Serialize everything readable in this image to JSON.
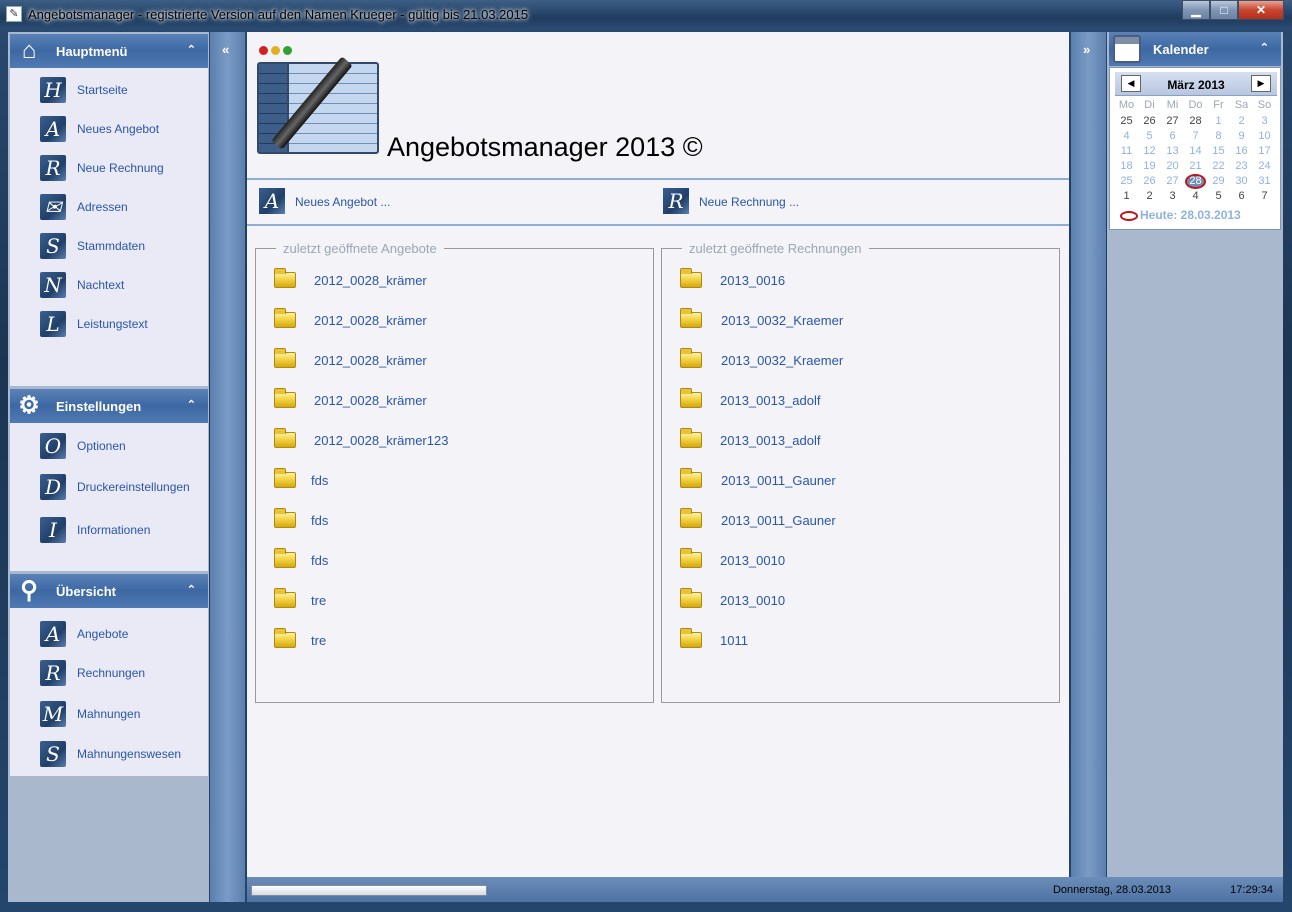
{
  "window": {
    "title": "Angebotsmanager - registrierte Version auf den Namen Krueger - gültig bis 21.03.2015",
    "minimize": "▁",
    "maximize": "□",
    "close": "✕"
  },
  "sidebar": {
    "hauptmenu": {
      "title": "Hauptmenü",
      "icon": "house-icon",
      "items": [
        {
          "letter": "H",
          "label": "Startseite"
        },
        {
          "letter": "A",
          "label": "Neues Angebot"
        },
        {
          "letter": "R",
          "label": "Neue Rechnung"
        },
        {
          "letter": "✉",
          "label": "Adressen"
        },
        {
          "letter": "S",
          "label": "Stammdaten"
        },
        {
          "letter": "N",
          "label": "Nachtext"
        },
        {
          "letter": "L",
          "label": "Leistungstext"
        }
      ]
    },
    "einstellungen": {
      "title": "Einstellungen",
      "icon": "gear-icon",
      "items": [
        {
          "letter": "O",
          "label": "Optionen"
        },
        {
          "letter": "D",
          "label": "Druckereinstellungen"
        },
        {
          "letter": "I",
          "label": "Informationen"
        }
      ]
    },
    "uebersicht": {
      "title": "Übersicht",
      "icon": "magnifier-icon",
      "items": [
        {
          "letter": "A",
          "label": "Angebote"
        },
        {
          "letter": "R",
          "label": "Rechnungen"
        },
        {
          "letter": "M",
          "label": "Mahnungen"
        },
        {
          "letter": "S",
          "label": "Mahnungenswesen"
        }
      ]
    },
    "collapse_chevron": "⌃"
  },
  "strips": {
    "left_chevron": "«",
    "right_chevron": "»"
  },
  "main": {
    "app_title": "Angebotsmanager 2013 ©",
    "quick_links": [
      {
        "letter": "A",
        "label": "Neues Angebot ..."
      },
      {
        "letter": "R",
        "label": "Neue Rechnung ..."
      }
    ],
    "recent_offers": {
      "title": "zuletzt geöffnete Angebote",
      "items": [
        "2012_0028_krämer",
        "2012_0028_krämer",
        "2012_0028_krämer",
        "2012_0028_krämer",
        "2012_0028_krämer123",
        "fds",
        "fds",
        "fds",
        "tre",
        "tre"
      ]
    },
    "recent_invoices": {
      "title": "zuletzt geöffnete Rechnungen",
      "items": [
        "2013_0016",
        "2013_0032_Kraemer",
        "2013_0032_Kraemer",
        "2013_0013_adolf",
        "2013_0013_adolf",
        "2013_0011_Gauner",
        "2013_0011_Gauner",
        "2013_0010",
        "2013_0010",
        "1011"
      ]
    }
  },
  "calendar": {
    "title": "Kalender",
    "month": "März 2013",
    "prev": "◀",
    "next": "▶",
    "weekdays": [
      "Mo",
      "Di",
      "Mi",
      "Do",
      "Fr",
      "Sa",
      "So"
    ],
    "weeks": [
      [
        "25",
        "26",
        "27",
        "28",
        "1",
        "2",
        "3"
      ],
      [
        "4",
        "5",
        "6",
        "7",
        "8",
        "9",
        "10"
      ],
      [
        "11",
        "12",
        "13",
        "14",
        "15",
        "16",
        "17"
      ],
      [
        "18",
        "19",
        "20",
        "21",
        "22",
        "23",
        "24"
      ],
      [
        "25",
        "26",
        "27",
        "28",
        "29",
        "30",
        "31"
      ],
      [
        "1",
        "2",
        "3",
        "4",
        "5",
        "6",
        "7"
      ]
    ],
    "today_label": "Heute: 28.03.2013"
  },
  "statusbar": {
    "progress": 0,
    "date": "Donnerstag, 28.03.2013",
    "time": "17:29:34"
  }
}
